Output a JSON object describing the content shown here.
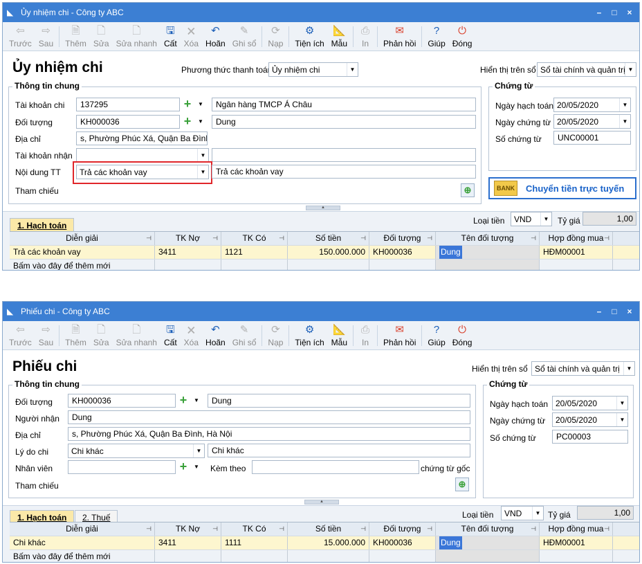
{
  "toolbar": {
    "items": [
      {
        "label": "Trước",
        "icon": "arrow-left-icon",
        "glyph": "⇦",
        "dis": true
      },
      {
        "label": "Sau",
        "icon": "arrow-right-icon",
        "glyph": "⇨",
        "dis": true
      },
      {
        "label": "Thêm",
        "icon": "add-doc-icon",
        "glyph": "🗎",
        "dis": true
      },
      {
        "label": "Sửa",
        "icon": "edit-doc-icon",
        "glyph": "🗋",
        "dis": true
      },
      {
        "label": "Sửa nhanh",
        "icon": "quick-edit-icon",
        "glyph": "🗋",
        "dis": true
      },
      {
        "label": "Cất",
        "icon": "save-icon",
        "glyph": "🖫",
        "dis": false
      },
      {
        "label": "Xóa",
        "icon": "delete-icon",
        "glyph": "🗙",
        "dis": true
      },
      {
        "label": "Hoãn",
        "icon": "undo-icon",
        "glyph": "↶",
        "dis": false
      },
      {
        "label": "Ghi sổ",
        "icon": "post-icon",
        "glyph": "✎",
        "dis": true
      },
      {
        "label": "Nạp",
        "icon": "reload-icon",
        "glyph": "⟳",
        "dis": true
      },
      {
        "label": "Tiện ích",
        "icon": "utility-icon",
        "glyph": "⚙",
        "dis": false
      },
      {
        "label": "Mẫu",
        "icon": "template-icon",
        "glyph": "📐",
        "dis": false
      },
      {
        "label": "In",
        "icon": "print-icon",
        "glyph": "⎙",
        "dis": true
      },
      {
        "label": "Phản hồi",
        "icon": "feedback-icon",
        "glyph": "✉",
        "dis": false
      },
      {
        "label": "Giúp",
        "icon": "help-icon",
        "glyph": "?",
        "dis": false
      },
      {
        "label": "Đóng",
        "icon": "close-doc-icon",
        "glyph": "⏻",
        "dis": false
      }
    ]
  },
  "w1": {
    "window_title": "Ủy nhiệm chi - Công ty ABC",
    "heading": "Ủy nhiệm chi",
    "payment_method_label": "Phương thức thanh toán",
    "payment_method": "Ủy nhiệm chi",
    "display_label": "Hiển thị trên sổ",
    "display_value": "Sổ tài chính và quản trị",
    "general_group": "Thông tin chung",
    "voucher_group": "Chứng từ",
    "account_label": "Tài khoản chi",
    "account": "137295",
    "bank": "Ngân hàng TMCP Á Châu",
    "object_label": "Đối tượng",
    "object_code": "KH000036",
    "object_name": "Dung",
    "address_label": "Địa chỉ",
    "address": "s, Phường Phúc Xá, Quận Ba Đình, Hà Nội",
    "recv_label": "Tài khoản nhận",
    "recv_account": "",
    "recv_bank": "",
    "content_label": "Nội dung TT",
    "content_select": "Trả các khoản vay",
    "content_text": "Trả các khoản vay",
    "ref_label": "Tham chiếu",
    "post_date_label": "Ngày hạch toán",
    "post_date": "20/05/2020",
    "doc_date_label": "Ngày chứng từ",
    "doc_date": "20/05/2020",
    "doc_no_label": "Số chứng từ",
    "doc_no": "UNC00001",
    "transfer_label": "Chuyển tiền trực tuyến",
    "transfer_icon_text": "BANK",
    "tab_accounting": "1. Hạch toán",
    "currency_label": "Loại tiền",
    "currency": "VND",
    "rate_label": "Tỷ giá",
    "rate": "1,00",
    "columns": [
      "Diễn giải",
      "TK Nợ",
      "TK Có",
      "Số tiền",
      "Đối tượng",
      "Tên đối tượng",
      "Hợp đồng mua"
    ],
    "row": [
      "Trả các khoản vay",
      "3411",
      "1121",
      "150.000.000",
      "KH000036",
      "Dung",
      "HĐM00001"
    ],
    "add_row": "Bấm vào đây để thêm mới"
  },
  "w2": {
    "window_title": "Phiếu chi - Công ty ABC",
    "heading": "Phiếu chi",
    "display_label": "Hiển thị trên sổ",
    "display_value": "Sổ tài chính và quản trị",
    "general_group": "Thông tin chung",
    "voucher_group": "Chứng từ",
    "object_label": "Đối tượng",
    "object_code": "KH000036",
    "object_name": "Dung",
    "receiver_label": "Người nhận",
    "receiver": "Dung",
    "address_label": "Địa chỉ",
    "address": "s, Phường Phúc Xá, Quận Ba Đình, Hà Nội",
    "reason_label": "Lý do chi",
    "reason_select": "Chi khác",
    "reason_text": "Chi khác",
    "staff_label": "Nhân viên",
    "staff": "",
    "attach_label": "Kèm theo",
    "attach": "",
    "attach_suffix": "chứng từ gốc",
    "ref_label": "Tham chiếu",
    "post_date_label": "Ngày hạch toán",
    "post_date": "20/05/2020",
    "doc_date_label": "Ngày chứng từ",
    "doc_date": "20/05/2020",
    "doc_no_label": "Số chứng từ",
    "doc_no": "PC00003",
    "tab_accounting": "1. Hạch toán",
    "tab_tax": "2. Thuế",
    "currency_label": "Loại tiền",
    "currency": "VND",
    "rate_label": "Tỷ giá",
    "rate": "1,00",
    "columns": [
      "Diễn giải",
      "TK Nợ",
      "TK Có",
      "Số tiền",
      "Đối tượng",
      "Tên đối tượng",
      "Hợp đồng mua"
    ],
    "row": [
      "Chi khác",
      "3411",
      "1111",
      "15.000.000",
      "KH000036",
      "Dung",
      "HĐM00001"
    ],
    "add_row": "Bấm vào đây để thêm mới"
  },
  "window_controls": {
    "minimize": "–",
    "maximize": "□",
    "close": "×"
  },
  "colors": {
    "title_bar": "#3c7fd3",
    "selected_row": "#fdf6cf",
    "highlight": "#e0262a"
  }
}
